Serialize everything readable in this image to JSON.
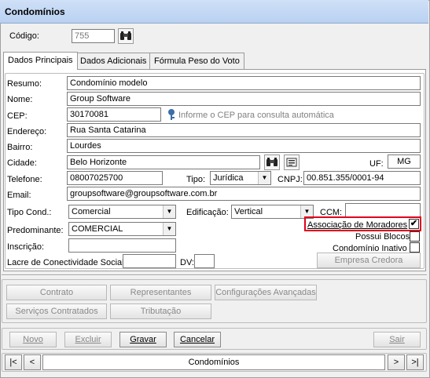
{
  "window": {
    "title": "Condomínios"
  },
  "codigo": {
    "label": "Código:",
    "value": "755",
    "search_icon": "binoculars-icon"
  },
  "tabs": [
    {
      "label": "Dados Principais"
    },
    {
      "label": "Dados Adicionais"
    },
    {
      "label": "Fórmula Peso do Voto"
    }
  ],
  "form": {
    "resumo": {
      "label": "Resumo:",
      "value": "Condomínio modelo"
    },
    "nome": {
      "label": "Nome:",
      "value": "Group Software"
    },
    "cep": {
      "label": "CEP:",
      "value": "30170081",
      "hint": "Informe o CEP para consulta automática",
      "hint_icon": "key-icon"
    },
    "endereco": {
      "label": "Endereço:",
      "value": "Rua Santa Catarina"
    },
    "bairro": {
      "label": "Bairro:",
      "value": "Lourdes"
    },
    "cidade": {
      "label": "Cidade:",
      "value": "Belo Horizonte",
      "search_icon": "binoculars-icon",
      "register_icon": "register-icon"
    },
    "uf": {
      "label": "UF:",
      "value": "MG"
    },
    "telefone": {
      "label": "Telefone:",
      "value": "08007025700"
    },
    "tipo": {
      "label": "Tipo:",
      "value": "Jurídica"
    },
    "cnpj": {
      "label": "CNPJ:",
      "value": "00.851.355/0001-94"
    },
    "email": {
      "label": "Email:",
      "value": "groupsoftware@groupsoftware.com.br"
    },
    "tipo_cond": {
      "label": "Tipo Cond.:",
      "value": "Comercial"
    },
    "edificacao": {
      "label": "Edificação:",
      "value": "Vertical"
    },
    "ccm": {
      "label": "CCM:",
      "value": ""
    },
    "predominante": {
      "label": "Predominante:",
      "value": "COMERCIAL"
    },
    "inscricao": {
      "label": "Inscrição:",
      "value": ""
    },
    "lacre": {
      "label": "Lacre de Conectividade Social:",
      "value": ""
    },
    "dv": {
      "label": "DV:",
      "value": ""
    },
    "associacao": {
      "label": "Associação de Moradores",
      "checked": true,
      "mark": "✔"
    },
    "possui_blocos": {
      "label": "Possui Blocos",
      "checked": false
    },
    "condominio_inativo": {
      "label": "Condomínio Inativo",
      "checked": false
    },
    "empresa_credora": {
      "label": "Empresa Credora"
    }
  },
  "action_buttons": {
    "contrato": "Contrato",
    "representantes": "Representantes",
    "configuracoes": "Configurações Avançadas",
    "servicos": "Serviços Contratados",
    "tributacao": "Tributação"
  },
  "toolbar": {
    "novo": "Novo",
    "excluir": "Excluir",
    "gravar": "Gravar",
    "cancelar": "Cancelar",
    "sair": "Sair"
  },
  "navigator": {
    "first": "|<",
    "prev": "<",
    "label": "Condomínios",
    "next": ">",
    "last": ">|"
  },
  "colors": {
    "highlight_border": "#e0001b",
    "title_bg": "#c5daf5"
  }
}
